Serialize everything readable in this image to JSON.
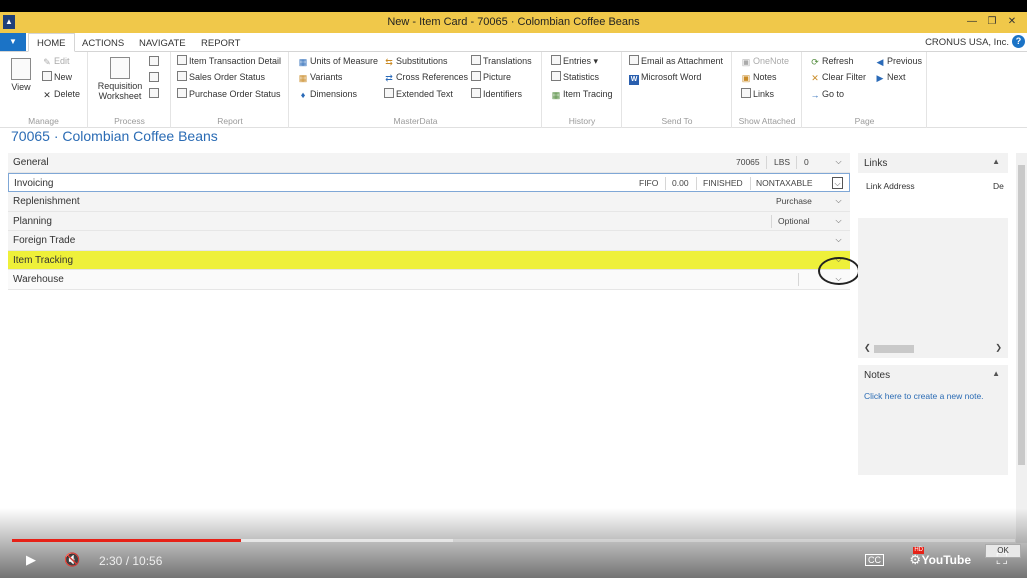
{
  "window": {
    "title": "New - Item Card - 70065 · Colombian Coffee Beans",
    "logo": "Nav",
    "controls": [
      "minimize-icon",
      "restore-icon",
      "close-icon"
    ]
  },
  "ribbon": {
    "tabs": [
      "HOME",
      "ACTIONS",
      "NAVIGATE",
      "REPORT"
    ],
    "active_tab": "HOME",
    "company": "CRONUS USA, Inc.",
    "groups": {
      "manage": {
        "label": "Manage",
        "view": "View",
        "edit": "Edit",
        "new": "New",
        "delete": "Delete"
      },
      "process": {
        "label": "Process",
        "requisition_line1": "Requisition",
        "requisition_line2": "Worksheet"
      },
      "report": {
        "label": "Report",
        "items": [
          "Item Transaction Detail",
          "Sales Order Status",
          "Purchase Order Status"
        ]
      },
      "masterdata": {
        "label": "MasterData",
        "col1": [
          "Units of Measure",
          "Variants",
          "Dimensions"
        ],
        "col2": [
          "Substitutions",
          "Cross References",
          "Extended Text"
        ],
        "col3": [
          "Translations",
          "Picture",
          "Identifiers"
        ]
      },
      "history": {
        "label": "History",
        "items": [
          "Entries",
          "Statistics",
          "Item Tracing"
        ]
      },
      "sendto": {
        "label": "Send To",
        "items": [
          "Email as Attachment",
          "Microsoft Word"
        ]
      },
      "showattached": {
        "label": "Show Attached",
        "items": [
          "OneNote",
          "Notes",
          "Links"
        ]
      },
      "page": {
        "label": "Page",
        "col1": [
          "Refresh",
          "Clear Filter",
          "Go to"
        ],
        "col2": [
          "Previous",
          "Next"
        ]
      }
    }
  },
  "page": {
    "title": "70065 · Colombian Coffee Beans",
    "fasttabs": [
      {
        "label": "General",
        "values": [
          "70065",
          "LBS",
          "0"
        ]
      },
      {
        "label": "Invoicing",
        "values": [
          "FIFO",
          "0.00",
          "FINISHED",
          "NONTAXABLE"
        ]
      },
      {
        "label": "Replenishment",
        "values": [
          "Purchase"
        ]
      },
      {
        "label": "Planning",
        "values": [
          "Optional"
        ]
      },
      {
        "label": "Foreign Trade",
        "values": []
      },
      {
        "label": "Item Tracking",
        "values": []
      },
      {
        "label": "Warehouse",
        "values": []
      }
    ]
  },
  "factboxes": {
    "links": {
      "title": "Links",
      "col1": "Link Address",
      "col2": "De"
    },
    "notes": {
      "title": "Notes",
      "link": "Click here to create a new note."
    }
  },
  "video": {
    "time": "2:30 / 10:56",
    "played_fraction": 0.2287,
    "loaded_fraction": 0.44,
    "ok_label": "OK",
    "hd_badge": "HD",
    "cc_label": "CC",
    "brand": "YouTube"
  }
}
